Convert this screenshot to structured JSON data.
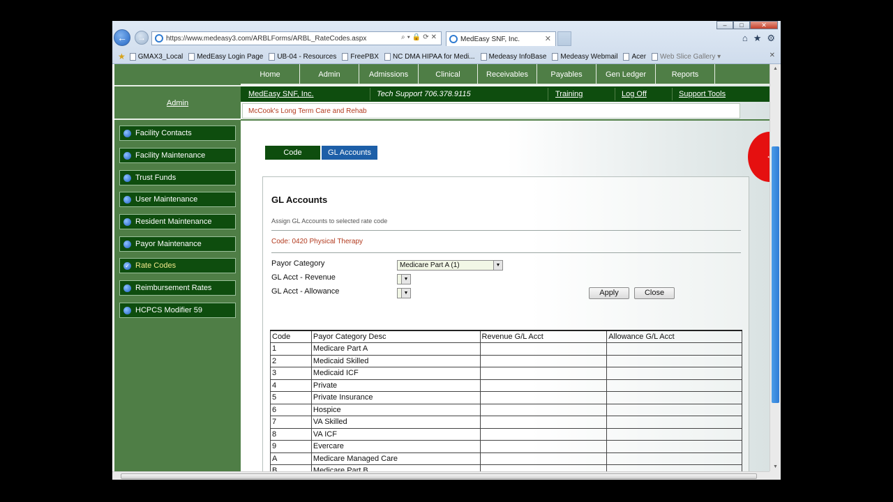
{
  "browser": {
    "url": "https://www.medeasy3.com/ARBLForms/ARBL_RateCodes.aspx",
    "tab_title": "MedEasy SNF, Inc.",
    "favorites": [
      "GMAX3_Local",
      "MedEasy Login Page",
      "UB-04 - Resources",
      "FreePBX",
      "NC DMA HIPAA for Medi...",
      "Medeasy InfoBase",
      "Medeasy Webmail",
      "Acer",
      "Web Slice Gallery ▾"
    ]
  },
  "top_nav": [
    "Home",
    "Admin",
    "Admissions",
    "Clinical",
    "Receivables",
    "Payables",
    "Gen Ledger",
    "Reports"
  ],
  "info_bar": {
    "company": "MedEasy SNF, Inc.",
    "support": "Tech Support 706.378.9115",
    "training": "Training",
    "logoff": "Log Off",
    "support_tools": "Support Tools"
  },
  "facility": "McCook's Long Term Care and Rehab",
  "sidebar": {
    "title": "Admin",
    "items": [
      {
        "label": "Facility Contacts"
      },
      {
        "label": "Facility Maintenance"
      },
      {
        "label": "Trust Funds"
      },
      {
        "label": "User Maintenance"
      },
      {
        "label": "Resident Maintenance"
      },
      {
        "label": "Payor Maintenance"
      },
      {
        "label": "Rate Codes"
      },
      {
        "label": "Reimbursement Rates"
      },
      {
        "label": "HCPCS Modifier 59"
      }
    ]
  },
  "tabs": {
    "code": "Code",
    "gl_accounts": "GL Accounts"
  },
  "panel": {
    "title": "GL Accounts",
    "subtitle": "Assign GL Accounts to selected rate code",
    "code_line": "Code: 0420 Physical Therapy",
    "payor_category_label": "Payor Category",
    "payor_category_value": "Medicare Part A (1)",
    "gl_revenue_label": "GL Acct - Revenue",
    "gl_allowance_label": "GL Acct - Allowance",
    "apply": "Apply",
    "close": "Close"
  },
  "table": {
    "headers": [
      "Code",
      "Payor Category Desc",
      "Revenue G/L Acct",
      "Allowance G/L Acct"
    ],
    "rows": [
      [
        "1",
        "Medicare Part A"
      ],
      [
        "2",
        "Medicaid Skilled"
      ],
      [
        "3",
        "Medicaid ICF"
      ],
      [
        "4",
        "Private"
      ],
      [
        "5",
        "Private Insurance"
      ],
      [
        "6",
        "Hospice"
      ],
      [
        "7",
        "VA Skilled"
      ],
      [
        "8",
        "VA ICF"
      ],
      [
        "9",
        "Evercare"
      ],
      [
        "A",
        "Medicare Managed Care"
      ],
      [
        "B",
        "Medicare Part B"
      ]
    ]
  }
}
